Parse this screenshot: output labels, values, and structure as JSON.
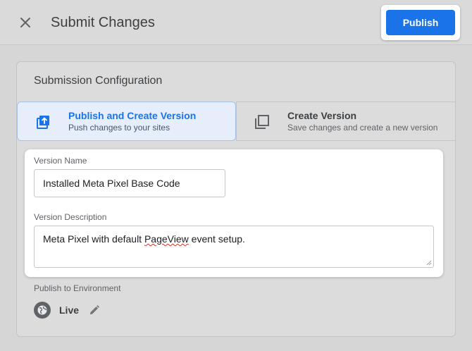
{
  "header": {
    "title": "Submit Changes",
    "publish_label": "Publish",
    "accent": "#1a73e8"
  },
  "config": {
    "title": "Submission Configuration",
    "options": [
      {
        "title": "Publish and Create Version",
        "subtitle": "Push changes to your sites",
        "selected": true,
        "icon": "publish-icon"
      },
      {
        "title": "Create Version",
        "subtitle": "Save changes and create a new version",
        "selected": false,
        "icon": "copy-icon"
      }
    ]
  },
  "form": {
    "version_name_label": "Version Name",
    "version_name_value": "Installed Meta Pixel Base Code",
    "version_description_label": "Version Description",
    "version_description_before": "Meta Pixel with default ",
    "version_description_misspelled": "PageView",
    "version_description_after": " event setup."
  },
  "environment": {
    "label": "Publish to Environment",
    "name": "Live",
    "icon": "globe-icon"
  }
}
